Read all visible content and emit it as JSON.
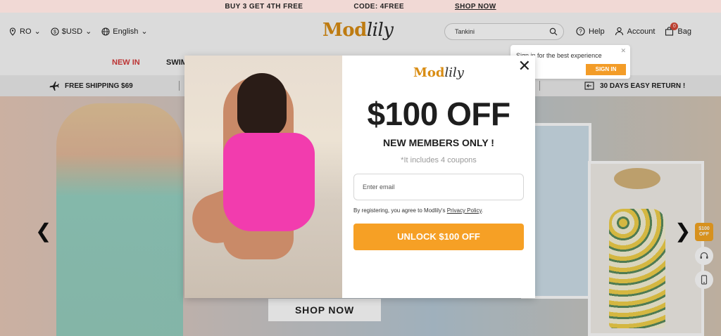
{
  "promo": {
    "offer": "BUY 3 GET 4TH FREE",
    "code": "CODE: 4FREE",
    "link": "SHOP NOW"
  },
  "header": {
    "region": "RO",
    "currency": "$USD",
    "language": "English",
    "logo_left": "Mod",
    "logo_right": "lily",
    "search_value": "Tankini",
    "help": "Help",
    "account": "Account",
    "bag": "Bag",
    "bag_count": "0"
  },
  "nav": {
    "new_in": "NEW IN",
    "swim": "SWIM"
  },
  "shipping": {
    "left": "FREE SHIPPING $69",
    "right": "30 DAYS EASY RETURN !"
  },
  "tooltip": {
    "text": "Sign in for the best experience",
    "button": "SIGN IN"
  },
  "hero": {
    "cta": "SHOP NOW",
    "side_promo": "$100 OFF"
  },
  "modal": {
    "logo_left": "Mod",
    "logo_right": "lily",
    "headline": "$100 OFF",
    "subheadline": "NEW MEMBERS ONLY !",
    "note": "*It includes 4 coupons",
    "email_placeholder": "Enter email",
    "terms_prefix": "By registering, you agree to Modlily's",
    "terms_link": "Privacy Policy",
    "terms_suffix": ".",
    "button": "UNLOCK $100 OFF"
  },
  "colors": {
    "accent": "#f6a025",
    "brand": "#d98d14",
    "new_in": "#d63b3b"
  }
}
